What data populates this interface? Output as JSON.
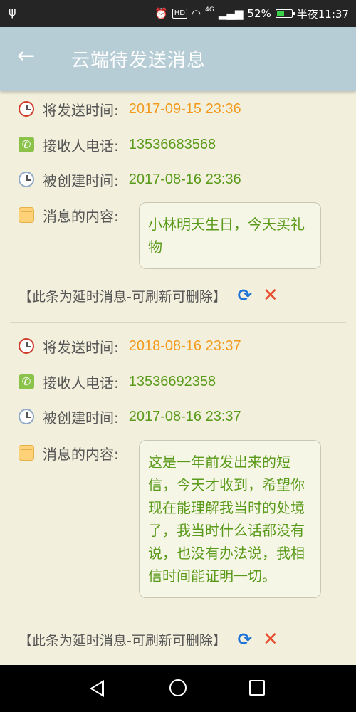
{
  "status_bar": {
    "battery_percent": "52%",
    "time": "半夜11:37",
    "hd_label": "HD",
    "network_label": "4G",
    "battery_level": 0.52
  },
  "app_bar": {
    "title": "云端待发送消息"
  },
  "messages": [
    {
      "send_time_label": "将发送时间:",
      "send_time": "2017-09-15 23:36",
      "phone_label": "接收人电话:",
      "phone": "13536683568",
      "created_label": "被创建时间:",
      "created": "2017-08-16 23:36",
      "content_label": "消息的内容:",
      "content": "小林明天生日，今天买礼物",
      "note": "【此条为延时消息-可刷新可删除】"
    },
    {
      "send_time_label": "将发送时间:",
      "send_time": "2018-08-16 23:37",
      "phone_label": "接收人电话:",
      "phone": "13536692358",
      "created_label": "被创建时间:",
      "created": "2017-08-16 23:37",
      "content_label": "消息的内容:",
      "content": "这是一年前发出来的短信，今天才收到，希望你现在能理解我当时的处境了，我当时什么话都没有说，也没有办法说，我相信时间能证明一切。",
      "note": "【此条为延时消息-可刷新可删除】"
    }
  ],
  "colors": {
    "app_bar": "#b7cdd6",
    "background": "#f2f0dc",
    "send_time": "#f39a1e",
    "value_green": "#5a9a1a"
  }
}
